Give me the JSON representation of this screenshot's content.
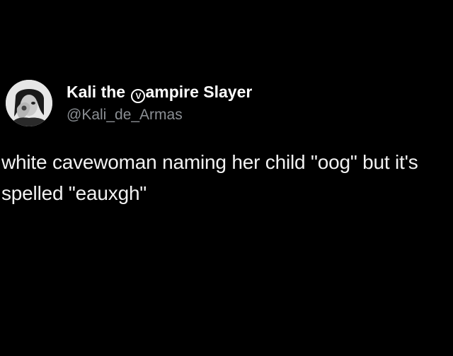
{
  "post": {
    "author": {
      "display_name_prefix": "Kali the ",
      "display_name_badge": "V",
      "display_name_suffix": "ampire Slayer",
      "handle": "@Kali_de_Armas",
      "avatar_icon": "avatar-portrait-icon"
    },
    "text": "white cavewoman naming her child \"oog\" but it's spelled \"eauxgh\""
  },
  "colors": {
    "background": "#000000",
    "name": "#ffffff",
    "handle": "#8b8f94",
    "text": "#f2f2f2"
  }
}
